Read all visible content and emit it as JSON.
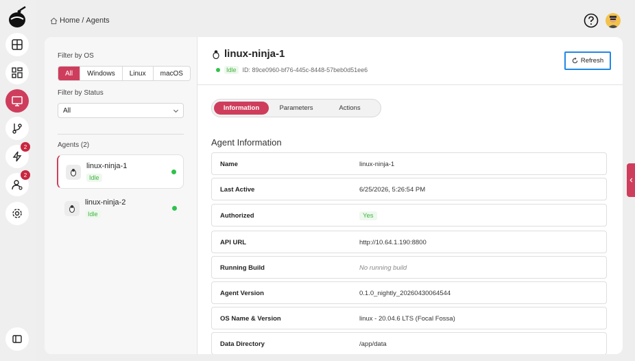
{
  "breadcrumb": {
    "home": "Home",
    "separator": "/",
    "current": "Agents"
  },
  "rail": {
    "items": [
      {
        "icon": "dashboard-icon"
      },
      {
        "icon": "grid-icon"
      },
      {
        "icon": "monitor-icon",
        "active": true
      },
      {
        "icon": "git-branch-icon"
      },
      {
        "icon": "lightning-icon",
        "badge": "2"
      },
      {
        "icon": "users-icon",
        "badge": "2"
      },
      {
        "icon": "gear-icon"
      },
      {
        "icon": "sidebar-toggle-icon"
      }
    ]
  },
  "filters": {
    "os_label": "Filter by OS",
    "os_options": [
      "All",
      "Windows",
      "Linux",
      "macOS"
    ],
    "os_selected": "All",
    "status_label": "Filter by Status",
    "status_value": "All"
  },
  "agents": {
    "heading": "Agents (2)",
    "items": [
      {
        "name": "linux-ninja-1",
        "status": "Idle"
      },
      {
        "name": "linux-ninja-2",
        "status": "Idle"
      }
    ]
  },
  "detail": {
    "title": "linux-ninja-1",
    "status": "Idle",
    "id_text": "ID: 89ce0960-bf76-445c-8448-57beb0d51ee6",
    "refresh_label": "Refresh",
    "tabs": [
      "Information",
      "Parameters",
      "Actions"
    ],
    "section_title": "Agent Information",
    "rows": [
      {
        "key": "Name",
        "value": "linux-ninja-1"
      },
      {
        "key": "Last Active",
        "value": "6/25/2026, 5:26:54 PM"
      },
      {
        "key": "Authorized",
        "value": "Yes"
      },
      {
        "key": "API URL",
        "value": "http://10.64.1.190:8800"
      },
      {
        "key": "Running Build",
        "value": "No running build"
      },
      {
        "key": "Agent Version",
        "value": "0.1.0_nightly_20260430064544"
      },
      {
        "key": "OS Name & Version",
        "value": "linux - 20.04.6 LTS (Focal Fossa)"
      },
      {
        "key": "Data Directory",
        "value": "/app/data"
      }
    ]
  },
  "colors": {
    "accent": "#cf3d5c",
    "idle_green": "#41b342",
    "focus_blue": "#1f87e6"
  }
}
